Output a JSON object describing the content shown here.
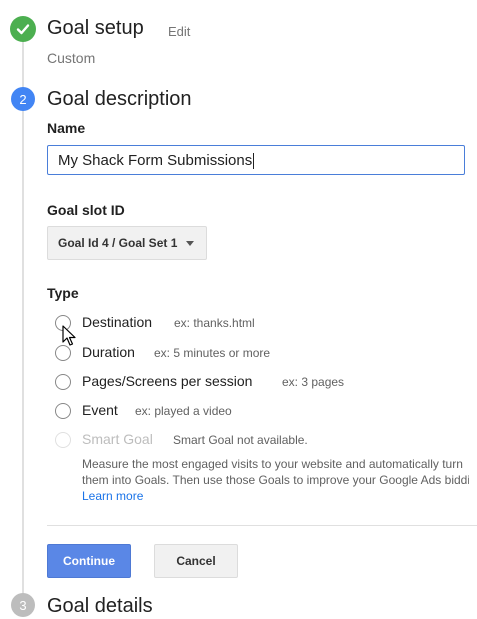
{
  "step1": {
    "title": "Goal setup",
    "edit_label": "Edit",
    "value": "Custom"
  },
  "step2": {
    "number": "2",
    "title": "Goal description",
    "name_label": "Name",
    "name_value": "My Shack Form Submissions",
    "slot_label": "Goal slot ID",
    "slot_value": "Goal Id 4 / Goal Set 1",
    "type_label": "Type",
    "options": [
      {
        "label": "Destination",
        "example": "ex: thanks.html"
      },
      {
        "label": "Duration",
        "example": "ex: 5 minutes or more"
      },
      {
        "label": "Pages/Screens per session",
        "example": "ex: 3 pages"
      },
      {
        "label": "Event",
        "example": "ex: played a video"
      },
      {
        "label": "Smart Goal",
        "example": "Smart Goal not available."
      }
    ],
    "smart_goal_help": "Measure the most engaged visits to your website and automatically turn them into Goals. Then use those Goals to improve your Google Ads bidding.",
    "learn_more": "Learn more",
    "continue_label": "Continue",
    "cancel_label": "Cancel"
  },
  "step3": {
    "number": "3",
    "title": "Goal details"
  },
  "colors": {
    "accent": "#4285f4",
    "success": "#4caf50",
    "primary_button": "#5a87e6"
  }
}
